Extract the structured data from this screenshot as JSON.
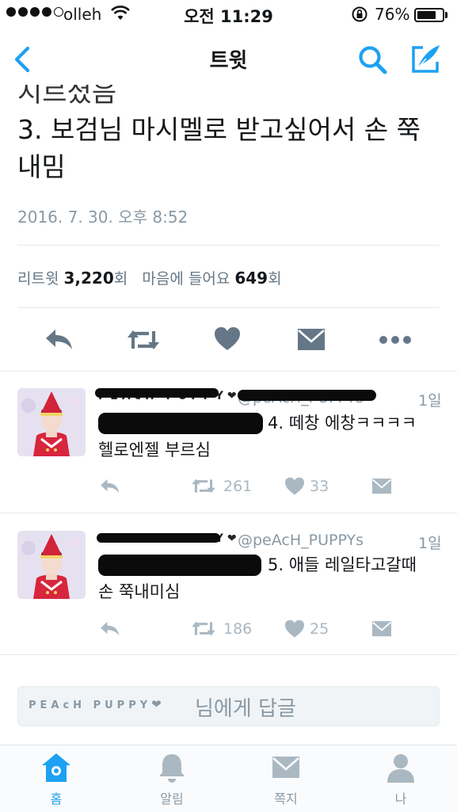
{
  "status_bar": {
    "carrier": "olleh",
    "time": "오전 11:29",
    "battery": "76%",
    "battery_level": 0.76
  },
  "nav": {
    "title": "트윗"
  },
  "tweet": {
    "clipped_line": "지르셨음",
    "text_line1": "3. 보검님 마시멜로 받고싶어서 손 쭉",
    "text_line2": "내밈",
    "date": "2016. 7. 30. 오후 8:52",
    "retweet_label": "리트윗",
    "retweet_count": "3,220",
    "count_suffix": "회",
    "like_label": "마음에 들어요",
    "like_count": "649",
    "like_suffix": "회"
  },
  "replies": [
    {
      "name": "PEAcH PUPPY",
      "heart": "❤",
      "handle": "@peAcH_PUPPYs",
      "ago": "1일",
      "text_tail": "4. 떼창 에창ㅋㅋㅋㅋ",
      "text_line2": "헬로엔젤 부르심",
      "retweets": "261",
      "likes": "33"
    },
    {
      "name": "PEAcH PUPPY",
      "heart": "❤",
      "handle": "@peAcH_PUPPYs",
      "ago": "1일",
      "text_tail": "5. 애들 레일타고갈때",
      "text_line2": "손 쭉내미심",
      "retweets": "186",
      "likes": "25"
    }
  ],
  "reply_box": {
    "name": "PEAcH PUPPY",
    "heart": "❤",
    "suffix": "님에게 답글"
  },
  "tab_bar": {
    "items": [
      {
        "label": "홈",
        "icon": "home-icon",
        "active": true
      },
      {
        "label": "알림",
        "icon": "bell-icon",
        "active": false
      },
      {
        "label": "쪽지",
        "icon": "envelope-icon",
        "active": false
      },
      {
        "label": "나",
        "icon": "person-icon",
        "active": false
      }
    ]
  },
  "colors": {
    "accent": "#1da1f2",
    "muted": "#8899a6",
    "icon_gray": "#aab8c2",
    "action_gray": "#657786"
  }
}
